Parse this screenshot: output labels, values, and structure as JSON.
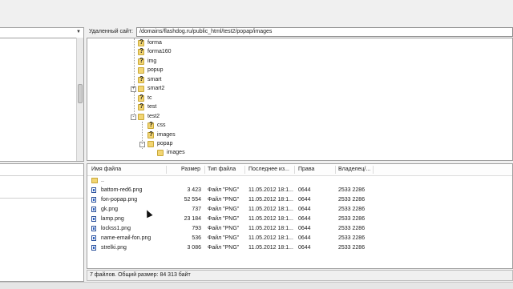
{
  "remote_site": {
    "label": "Удаленный сайт:",
    "path": "/domains/flashdog.ru/public_html/test2/popap/images"
  },
  "tree": {
    "nodes": [
      {
        "name": "forma",
        "icon": "question-folder-icon"
      },
      {
        "name": "forma160",
        "icon": "question-folder-icon"
      },
      {
        "name": "img",
        "icon": "question-folder-icon"
      },
      {
        "name": "popup",
        "icon": "folder-icon"
      },
      {
        "name": "smart",
        "icon": "question-folder-icon"
      },
      {
        "name": "smart2",
        "icon": "folder-icon",
        "expander": "+"
      },
      {
        "name": "tc",
        "icon": "question-folder-icon"
      },
      {
        "name": "test",
        "icon": "question-folder-icon"
      },
      {
        "name": "test2",
        "icon": "folder-icon",
        "expander": "-"
      },
      {
        "name": "css",
        "icon": "question-folder-icon"
      },
      {
        "name": "images",
        "icon": "question-folder-icon"
      },
      {
        "name": "popap",
        "icon": "folder-icon",
        "expander": "-"
      },
      {
        "name": "images",
        "icon": "folder-icon"
      }
    ]
  },
  "filelist": {
    "columns": [
      "Имя файла",
      "Размер",
      "Тип файла",
      "Последнее из...",
      "Права",
      "Владелец/..."
    ],
    "up_row": "..",
    "rows": [
      {
        "name": "battom-red6.png",
        "size": "3 423",
        "type": "Файл \"PNG\"",
        "modified": "11.05.2012 18:1...",
        "perms": "0644",
        "owner": "2533 2286"
      },
      {
        "name": "fon-popap.png",
        "size": "52 554",
        "type": "Файл \"PNG\"",
        "modified": "11.05.2012 18:1...",
        "perms": "0644",
        "owner": "2533 2286"
      },
      {
        "name": "gk.png",
        "size": "737",
        "type": "Файл \"PNG\"",
        "modified": "11.05.2012 18:1...",
        "perms": "0644",
        "owner": "2533 2286"
      },
      {
        "name": "lamp.png",
        "size": "23 184",
        "type": "Файл \"PNG\"",
        "modified": "11.05.2012 18:1...",
        "perms": "0644",
        "owner": "2533 2286"
      },
      {
        "name": "lockss1.png",
        "size": "793",
        "type": "Файл \"PNG\"",
        "modified": "11.05.2012 18:1...",
        "perms": "0644",
        "owner": "2533 2286"
      },
      {
        "name": "name-email-fon.png",
        "size": "536",
        "type": "Файл \"PNG\"",
        "modified": "11.05.2012 18:1...",
        "perms": "0644",
        "owner": "2533 2286"
      },
      {
        "name": "strelki.png",
        "size": "3 086",
        "type": "Файл \"PNG\"",
        "modified": "11.05.2012 18:1...",
        "perms": "0644",
        "owner": "2533 2286"
      }
    ]
  },
  "status": "7 файлов. Общий размер: 84 313 байт"
}
